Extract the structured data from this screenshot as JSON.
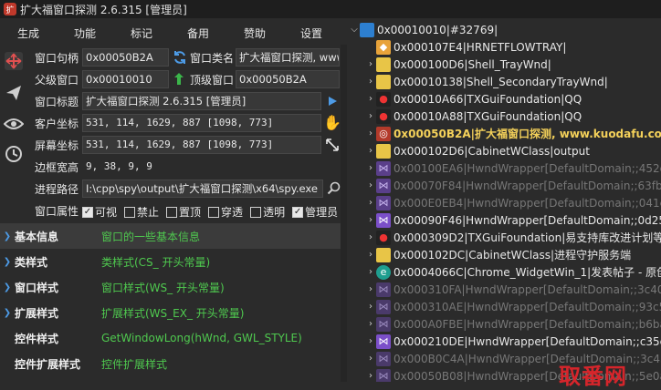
{
  "title": {
    "text": "扩大福窗口探测 2.6.315  [管理员]"
  },
  "menu": [
    "生成",
    "功能",
    "标记",
    "备用",
    "赞助",
    "设置"
  ],
  "fields": {
    "handle_label": "窗口句柄",
    "handle": "0x00050B2A",
    "classname_label": "窗口类名",
    "classname": "扩大福窗口探测, www.kud",
    "parent_label": "父级窗口",
    "parent": "0x00010010",
    "toplevel_label": "顶级窗口",
    "toplevel": "0x00050B2A",
    "wtitle_label": "窗口标题",
    "wtitle": "扩大福窗口探测 2.6.315  [管理员]",
    "client_label": "客户坐标",
    "client": " 531,   114,   1629,    887 [1098, 773]",
    "screen_label": "屏幕坐标",
    "screen": " 531,   114,   1629,    887 [1098, 773]",
    "border_label": "边框宽高",
    "border": "   9,     38,      9,       9",
    "path_label": "进程路径",
    "path": "I:\\cpp\\spy\\output\\扩大福窗口探测\\x64\\spy.exe"
  },
  "attrs": {
    "label": "窗口属性",
    "items": [
      {
        "label": "可视",
        "checked": true
      },
      {
        "label": "禁止",
        "checked": false
      },
      {
        "label": "置顶",
        "checked": false
      },
      {
        "label": "穿透",
        "checked": false
      },
      {
        "label": "透明",
        "checked": false
      },
      {
        "label": "管理员",
        "checked": true
      }
    ]
  },
  "props": [
    {
      "name": "基本信息",
      "value": "窗口的一些基本信息"
    },
    {
      "name": "类样式",
      "value": "类样式(CS_ 开头常量)"
    },
    {
      "name": "窗口样式",
      "value": "窗口样式(WS_ 开头常量)"
    },
    {
      "name": "扩展样式",
      "value": "扩展样式(WS_EX_ 开头常量)"
    },
    {
      "name": "控件样式",
      "value": "GetWindowLong(hWnd, GWL_STYLE)"
    },
    {
      "name": "控件扩展样式",
      "value": "控件扩展样式"
    }
  ],
  "tree": [
    {
      "text": "0x00010010|#32769|",
      "icon": "desktop-icon"
    },
    {
      "text": "0x000107E4|HRNETFLOWTRAY|",
      "icon": "shield-icon"
    },
    {
      "text": "0x000100D6|Shell_TrayWnd|",
      "icon": "taskbar-icon"
    },
    {
      "text": "0x00010138|Shell_SecondaryTrayWnd|",
      "icon": "taskbar-icon"
    },
    {
      "text": "0x00010A66|TXGuiFoundation|QQ",
      "icon": "qq-icon"
    },
    {
      "text": "0x00010A88|TXGuiFoundation|QQ",
      "icon": "qq-icon"
    },
    {
      "text": "0x00050B2A|扩大福窗口探测, www.kuodafu.com|扩",
      "icon": "spy-icon"
    },
    {
      "text": "0x000102D6|CabinetWClass|output",
      "icon": "folder-icon"
    },
    {
      "text": "0x00100EA6|HwndWrapper[DefaultDomain;;452d8",
      "icon": "vs-icon"
    },
    {
      "text": "0x00070F84|HwndWrapper[DefaultDomain;;63fbc5",
      "icon": "vs-icon"
    },
    {
      "text": "0x000E0EB4|HwndWrapper[DefaultDomain;;041c3",
      "icon": "vs-icon"
    },
    {
      "text": "0x00090F46|HwndWrapper[DefaultDomain;;0d25f3",
      "icon": "vs-icon"
    },
    {
      "text": "0x000309D2|TXGuiFoundation|易支持库改进计划等6",
      "icon": "qq-icon"
    },
    {
      "text": "0x000102DC|CabinetWClass|进程守护服务端",
      "icon": "folder-icon"
    },
    {
      "text": "0x0004066C|Chrome_WidgetWin_1|发表帖子 - 原创",
      "icon": "edge-icon"
    },
    {
      "text": "0x000310FA|HwndWrapper[DefaultDomain;;3c40c",
      "icon": "vs-icon"
    },
    {
      "text": "0x000310AE|HwndWrapper[DefaultDomain;;93c52",
      "icon": "vs-icon"
    },
    {
      "text": "0x000A0FBE|HwndWrapper[DefaultDomain;;b6ba6",
      "icon": "vs-icon"
    },
    {
      "text": "0x000210DE|HwndWrapper[DefaultDomain;;c35e5",
      "icon": "vs-icon"
    },
    {
      "text": "0x000B0C4A|HwndWrapper[DefaultDomain;;3c43f",
      "icon": "vs-icon"
    },
    {
      "text": "0x00050B08|HwndWrapper[DefaultDomain;;5e0ad",
      "icon": "vs-icon"
    }
  ],
  "watermark": "取番网",
  "colors": {
    "accent": "#4d9be6",
    "prop_value": "#4fc94f",
    "highlight": "#f4d15a",
    "watermark": "#d6252b"
  }
}
